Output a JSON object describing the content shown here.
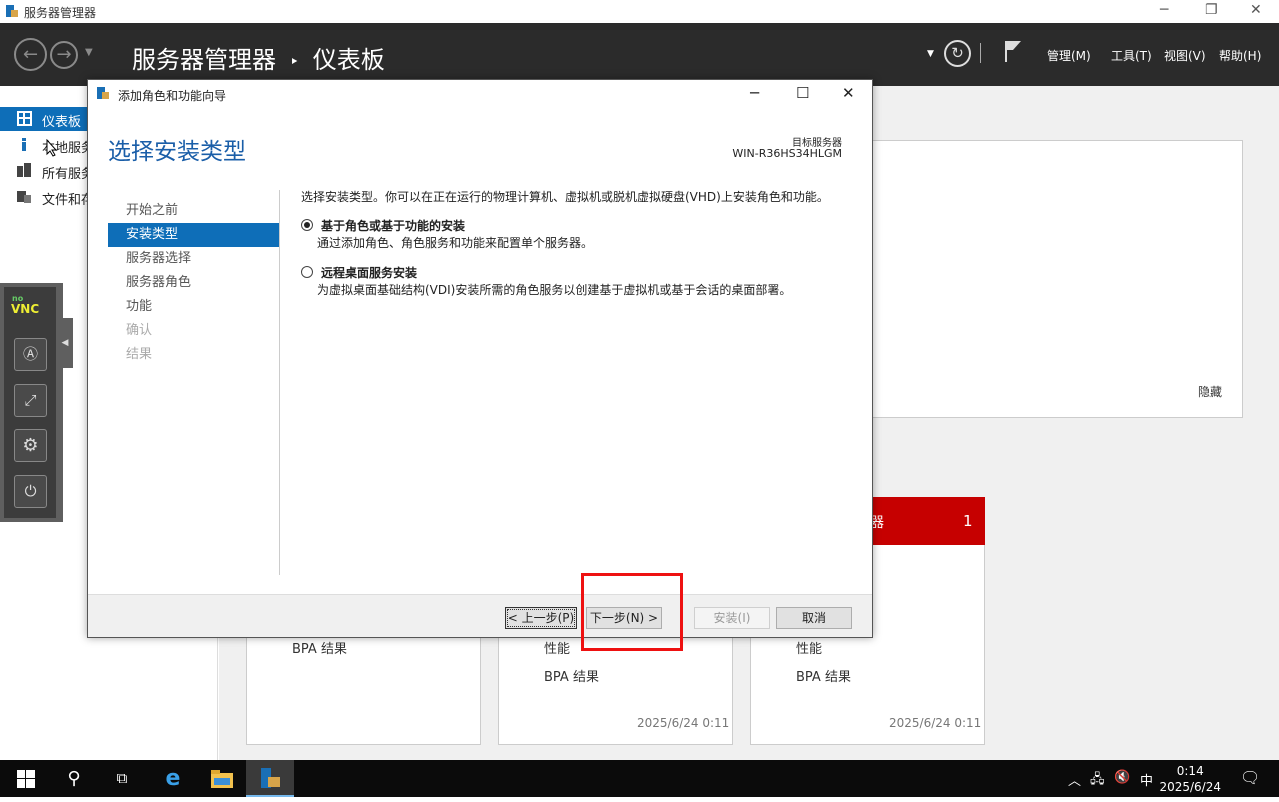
{
  "app": {
    "title": "服务器管理器",
    "breadcrumb_root": "服务器管理器",
    "breadcrumb_sep": "‣",
    "breadcrumb_page": "仪表板",
    "menus": [
      "管理(M)",
      "工具(T)",
      "视图(V)",
      "帮助(H)"
    ]
  },
  "leftnav": {
    "items": [
      "仪表板",
      "本地服务",
      "所有服务",
      "文件和存"
    ]
  },
  "welcome": {
    "hide_label": "隐藏"
  },
  "tiles": {
    "red_count": "1",
    "red_label": "器",
    "perf_label": "性能",
    "bpa_label": "BPA 结果",
    "timestamp": "2025/6/24 0:11"
  },
  "vnc": {
    "logo_top": "no",
    "logo_bottom": "VNC"
  },
  "dialog": {
    "title": "添加角色和功能向导",
    "heading": "选择安装类型",
    "target_label": "目标服务器",
    "target_name": "WIN-R36HS34HLGM",
    "steps": [
      "开始之前",
      "安装类型",
      "服务器选择",
      "服务器角色",
      "功能",
      "确认",
      "结果"
    ],
    "description": "选择安装类型。你可以在正在运行的物理计算机、虚拟机或脱机虚拟硬盘(VHD)上安装角色和功能。",
    "options": [
      {
        "label": "基于角色或基于功能的安装",
        "desc": "通过添加角色、角色服务和功能来配置单个服务器。",
        "selected": true
      },
      {
        "label": "远程桌面服务安装",
        "desc": "为虚拟桌面基础结构(VDI)安装所需的角色服务以创建基于虚拟机或基于会话的桌面部署。",
        "selected": false
      }
    ],
    "buttons": {
      "prev": "< 上一步(P)",
      "next": "下一步(N) >",
      "install": "安装(I)",
      "cancel": "取消"
    }
  },
  "taskbar": {
    "time": "0:14",
    "date": "2025/6/24",
    "ime": "中"
  },
  "colors": {
    "accent": "#0e6eb8",
    "header_bg": "#2b2b2b",
    "alert_red": "#c60000",
    "highlight_box": "#e11111"
  }
}
